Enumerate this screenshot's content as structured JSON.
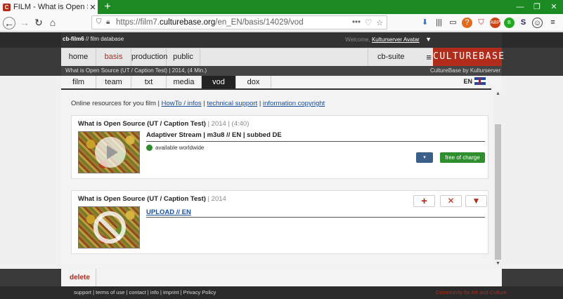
{
  "browser": {
    "tab_title": "FILM - What is Open Source (U",
    "tab_close": "✕",
    "new_tab": "+",
    "favicon_letter": "C",
    "url_prefix": "https://film7.",
    "url_domain": "culturebase.org",
    "url_path": "/en_EN/basis/14029/vod",
    "url_more": "•••",
    "window_min": "—",
    "window_max": "❐",
    "window_close": "✕"
  },
  "site": {
    "brand_bold": "cb-film6",
    "brand_rest": " // film database",
    "welcome_label": "Welcome,",
    "welcome_user": "Kulturserver Avatar",
    "nav": [
      "home",
      "basis",
      "production",
      "public"
    ],
    "nav_active": "basis",
    "suite": "cb-suite",
    "logo": "CULTUREBASE",
    "crumb_left": "What is Open Source (UT / Caption Test) | 2014, (4 Min.)",
    "crumb_right": "CultureBase by Kulturserver"
  },
  "subtabs": {
    "items": [
      "film",
      "team",
      "txt",
      "media",
      "vod",
      "dox"
    ],
    "active": "vod",
    "lang": "EN"
  },
  "intro": {
    "text": "Online resources for you film |",
    "links": [
      "HowTo / infos",
      "technical support",
      "information copyright"
    ],
    "sep": "|"
  },
  "card1": {
    "title": "What is Open Source (UT / Caption Test)",
    "meta": " | 2014 | (4:40)",
    "stream": "Adaptiver Stream | m3u8 // EN | subbed DE",
    "availability": "available worldwide",
    "dropdown_glyph": "▾",
    "free_label": "free of charge"
  },
  "card2": {
    "title": "What is Open Source (UT / Caption Test)",
    "meta": " | 2014",
    "upload_label": "UPLOAD // EN",
    "add_glyph": "+",
    "remove_glyph": "✕",
    "expand_glyph": "▼"
  },
  "footer": {
    "delete_label": "delete",
    "links": "support | terms of use | contact | info | imprint | Privacy Policy",
    "tagline": "Community for Art and Culture"
  },
  "colors": {
    "accent": "#b22c1c",
    "browser_green": "#1b8a23",
    "link": "#1a4fa0",
    "free_button": "#2f8f2f"
  }
}
